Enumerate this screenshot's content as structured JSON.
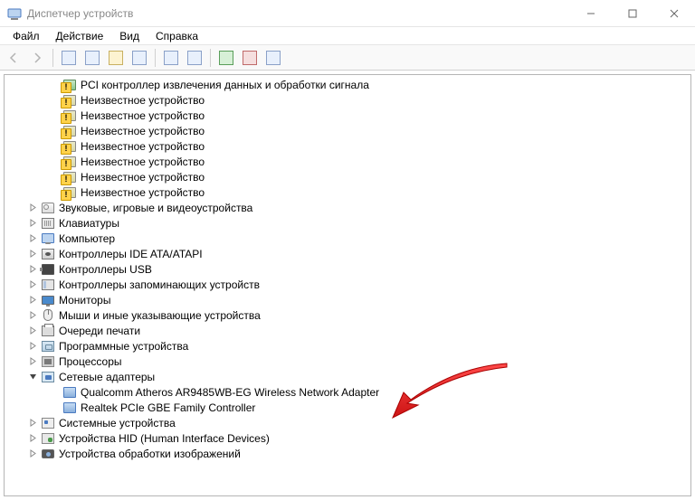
{
  "window": {
    "title": "Диспетчер устройств"
  },
  "menu": {
    "file": "Файл",
    "action": "Действие",
    "view": "Вид",
    "help": "Справка"
  },
  "tree": {
    "level2": [
      {
        "label": "PCI контроллер извлечения данных и обработки сигнала",
        "icon": "pci-warn"
      },
      {
        "label": "Неизвестное устройство",
        "icon": "unknown-warn"
      },
      {
        "label": "Неизвестное устройство",
        "icon": "unknown-warn"
      },
      {
        "label": "Неизвестное устройство",
        "icon": "unknown-warn"
      },
      {
        "label": "Неизвестное устройство",
        "icon": "unknown-warn"
      },
      {
        "label": "Неизвестное устройство",
        "icon": "unknown-warn"
      },
      {
        "label": "Неизвестное устройство",
        "icon": "unknown-warn"
      },
      {
        "label": "Неизвестное устройство",
        "icon": "unknown-warn"
      }
    ],
    "cats": [
      {
        "label": "Звуковые, игровые и видеоустройства",
        "icon": "audio",
        "arrow": "right"
      },
      {
        "label": "Клавиатуры",
        "icon": "keyboard",
        "arrow": "right"
      },
      {
        "label": "Компьютер",
        "icon": "computer",
        "arrow": "right"
      },
      {
        "label": "Контроллеры IDE ATA/ATAPI",
        "icon": "ide",
        "arrow": "right"
      },
      {
        "label": "Контроллеры USB",
        "icon": "usb",
        "arrow": "right"
      },
      {
        "label": "Контроллеры запоминающих устройств",
        "icon": "storage",
        "arrow": "right"
      },
      {
        "label": "Мониторы",
        "icon": "monitor",
        "arrow": "right"
      },
      {
        "label": "Мыши и иные указывающие устройства",
        "icon": "mouse",
        "arrow": "right"
      },
      {
        "label": "Очереди печати",
        "icon": "printer",
        "arrow": "right"
      },
      {
        "label": "Программные устройства",
        "icon": "software",
        "arrow": "right"
      },
      {
        "label": "Процессоры",
        "icon": "cpu",
        "arrow": "right"
      },
      {
        "label": "Сетевые адаптеры",
        "icon": "net",
        "arrow": "down",
        "children": [
          {
            "label": "Qualcomm Atheros AR9485WB-EG Wireless Network Adapter",
            "icon": "netcard"
          },
          {
            "label": "Realtek PCIe GBE Family Controller",
            "icon": "netcard"
          }
        ]
      },
      {
        "label": "Системные устройства",
        "icon": "sys",
        "arrow": "right"
      },
      {
        "label": "Устройства HID (Human Interface Devices)",
        "icon": "hid",
        "arrow": "right"
      },
      {
        "label": "Устройства обработки изображений",
        "icon": "imaging",
        "arrow": "right"
      }
    ]
  }
}
